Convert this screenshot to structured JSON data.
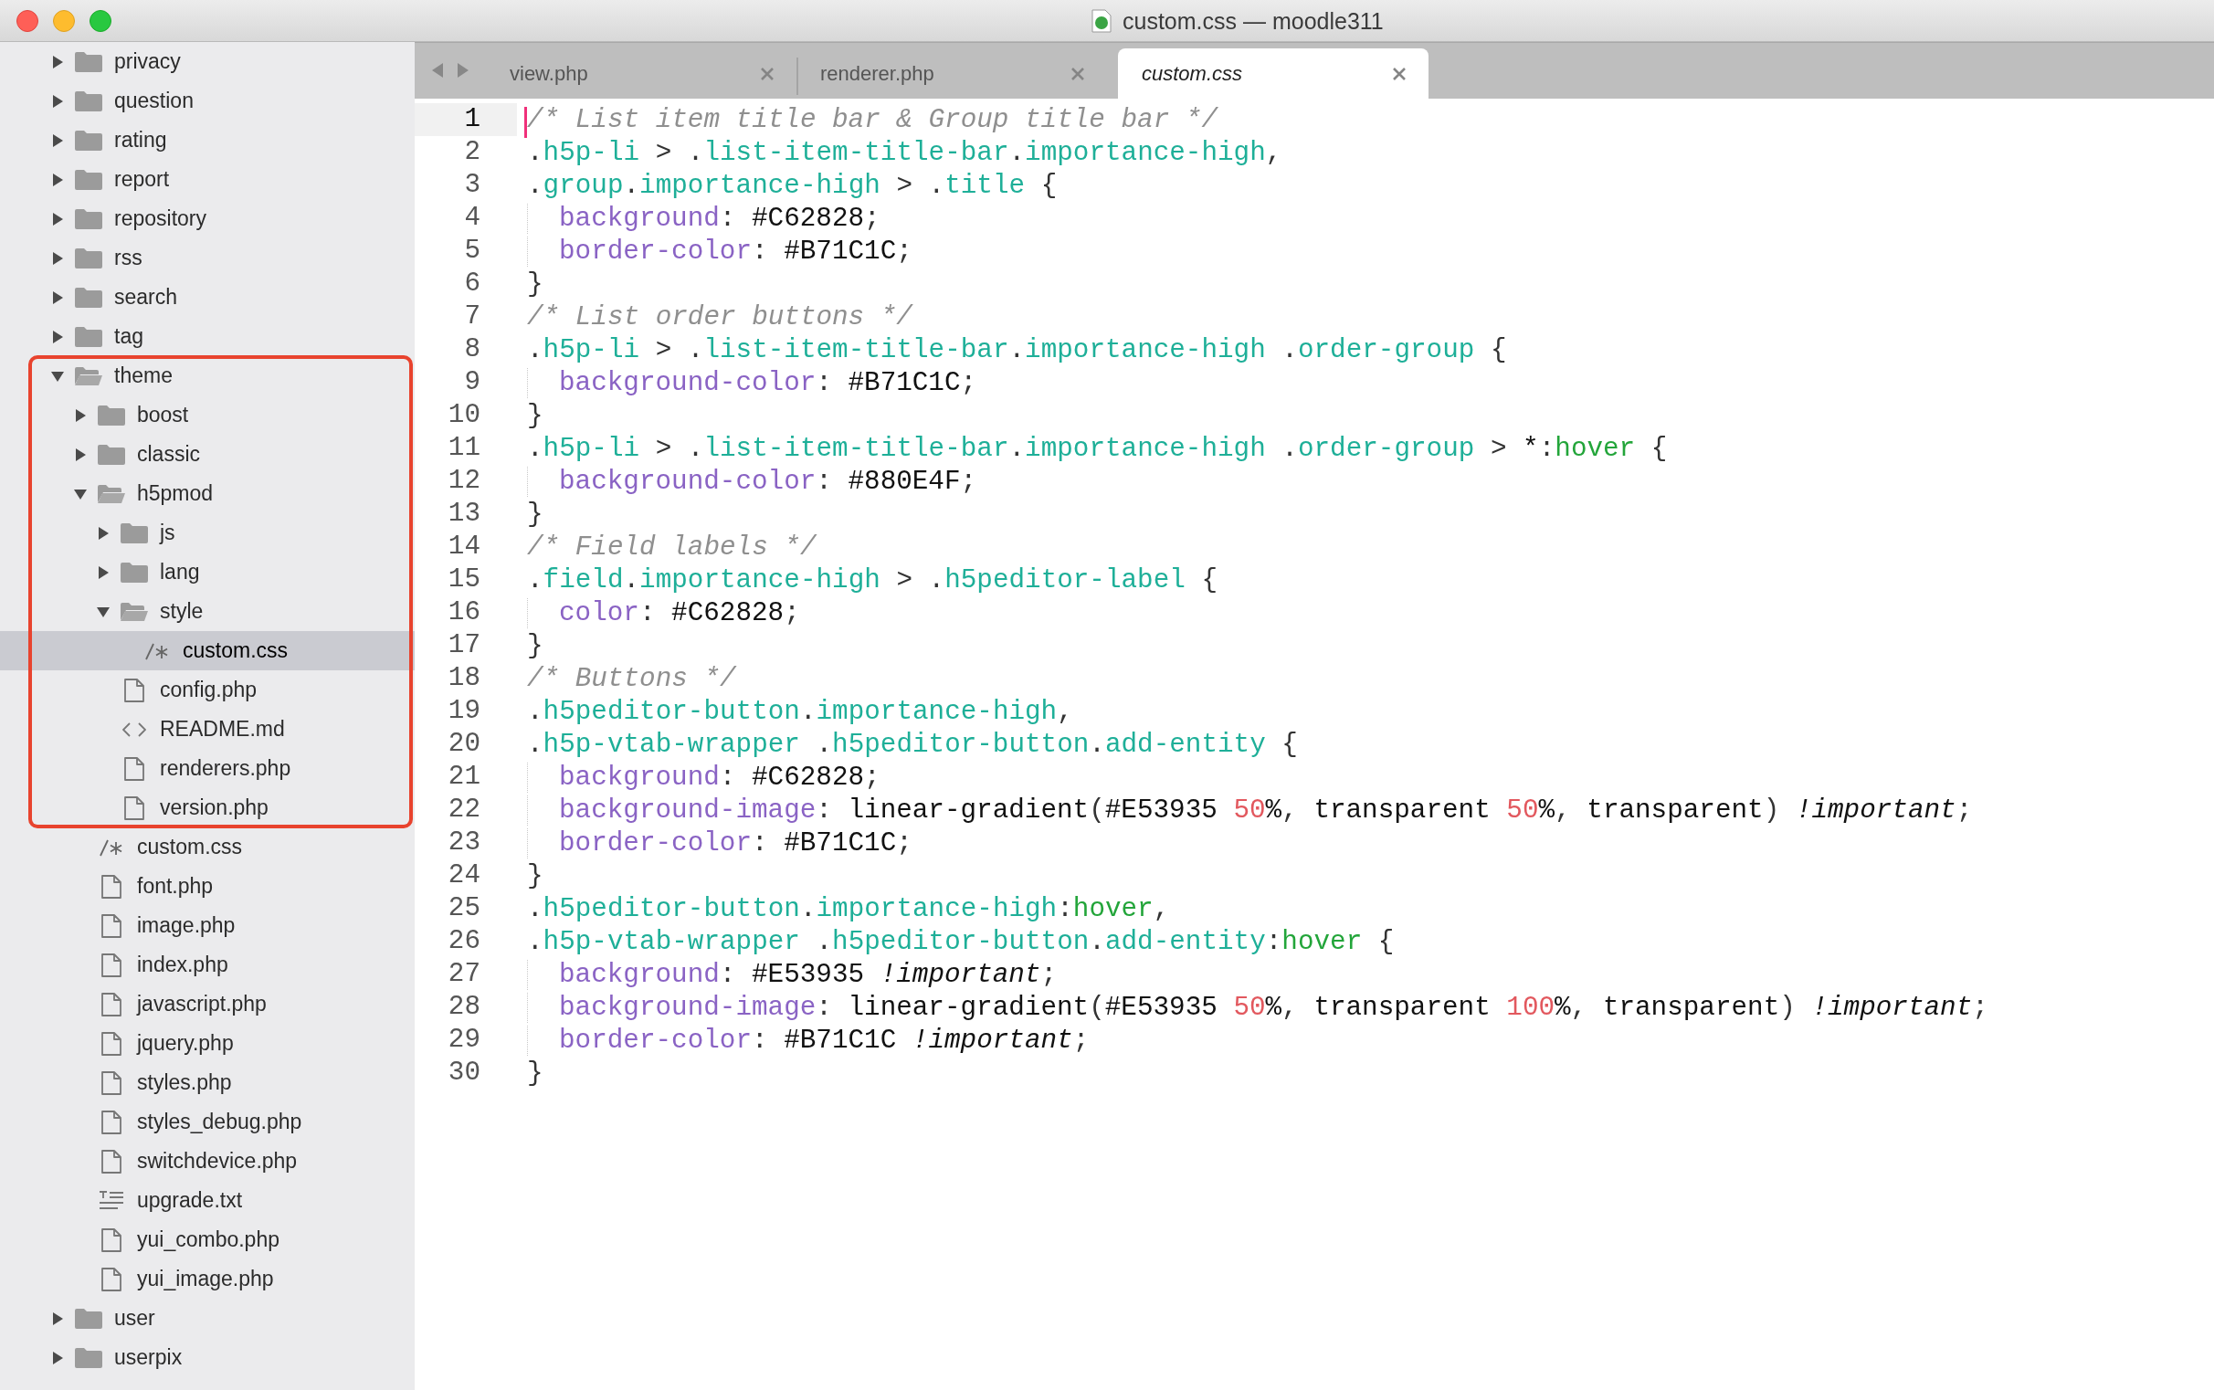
{
  "window": {
    "title": "custom.css — moodle311"
  },
  "sidebar": {
    "items": [
      {
        "name": "privacy",
        "kind": "folder",
        "expanded": false,
        "selected": false,
        "boxed": false
      },
      {
        "name": "question",
        "kind": "folder",
        "expanded": false,
        "selected": false,
        "boxed": false
      },
      {
        "name": "rating",
        "kind": "folder",
        "expanded": false,
        "selected": false,
        "boxed": false
      },
      {
        "name": "report",
        "kind": "folder",
        "expanded": false,
        "selected": false,
        "boxed": false
      },
      {
        "name": "repository",
        "kind": "folder",
        "expanded": false,
        "selected": false,
        "boxed": false
      },
      {
        "name": "rss",
        "kind": "folder",
        "expanded": false,
        "selected": false,
        "boxed": false
      },
      {
        "name": "search",
        "kind": "folder",
        "expanded": false,
        "selected": false,
        "boxed": false
      },
      {
        "name": "tag",
        "kind": "folder",
        "expanded": false,
        "selected": false,
        "boxed": false
      },
      {
        "name": "theme",
        "kind": "folder",
        "expanded": true,
        "selected": false,
        "boxed": true,
        "children": [
          {
            "name": "boost",
            "kind": "folder",
            "expanded": false,
            "selected": false,
            "boxed": true
          },
          {
            "name": "classic",
            "kind": "folder",
            "expanded": false,
            "selected": false,
            "boxed": true
          },
          {
            "name": "h5pmod",
            "kind": "folder",
            "expanded": true,
            "selected": false,
            "boxed": true,
            "children": [
              {
                "name": "js",
                "kind": "folder",
                "expanded": false,
                "selected": false,
                "boxed": true
              },
              {
                "name": "lang",
                "kind": "folder",
                "expanded": false,
                "selected": false,
                "boxed": true
              },
              {
                "name": "style",
                "kind": "folder",
                "expanded": true,
                "selected": false,
                "boxed": true,
                "children": [
                  {
                    "name": "custom.css",
                    "kind": "css",
                    "selected": true,
                    "boxed": true
                  }
                ]
              },
              {
                "name": "config.php",
                "kind": "page",
                "selected": false,
                "boxed": true
              },
              {
                "name": "README.md",
                "kind": "code",
                "selected": false,
                "boxed": true
              },
              {
                "name": "renderers.php",
                "kind": "page",
                "selected": false,
                "boxed": true
              },
              {
                "name": "version.php",
                "kind": "page",
                "selected": false,
                "boxed": true
              }
            ]
          },
          {
            "name": "custom.css",
            "kind": "css",
            "selected": false,
            "boxed": false
          },
          {
            "name": "font.php",
            "kind": "page",
            "selected": false,
            "boxed": false
          },
          {
            "name": "image.php",
            "kind": "page",
            "selected": false,
            "boxed": false
          },
          {
            "name": "index.php",
            "kind": "page",
            "selected": false,
            "boxed": false
          },
          {
            "name": "javascript.php",
            "kind": "page",
            "selected": false,
            "boxed": false
          },
          {
            "name": "jquery.php",
            "kind": "page",
            "selected": false,
            "boxed": false
          },
          {
            "name": "styles.php",
            "kind": "page",
            "selected": false,
            "boxed": false
          },
          {
            "name": "styles_debug.php",
            "kind": "page",
            "selected": false,
            "boxed": false
          },
          {
            "name": "switchdevice.php",
            "kind": "page",
            "selected": false,
            "boxed": false
          },
          {
            "name": "upgrade.txt",
            "kind": "text",
            "selected": false,
            "boxed": false
          },
          {
            "name": "yui_combo.php",
            "kind": "page",
            "selected": false,
            "boxed": false
          },
          {
            "name": "yui_image.php",
            "kind": "page",
            "selected": false,
            "boxed": false
          }
        ]
      },
      {
        "name": "user",
        "kind": "folder",
        "expanded": false,
        "selected": false,
        "boxed": false
      },
      {
        "name": "userpix",
        "kind": "folder",
        "expanded": false,
        "selected": false,
        "boxed": false
      }
    ]
  },
  "tabs": [
    {
      "label": "view.php",
      "selected": false
    },
    {
      "label": "renderer.php",
      "selected": false
    },
    {
      "label": "custom.css",
      "selected": true
    }
  ],
  "editor": {
    "lines": [
      {
        "number": "1",
        "current": true,
        "indented": false,
        "tokens": [
          {
            "kind": "comment",
            "text": "/* List item title bar & Group title bar */"
          }
        ]
      },
      {
        "number": "2",
        "current": false,
        "indented": false,
        "tokens": [
          {
            "kind": "punct",
            "text": "."
          },
          {
            "kind": "selector",
            "text": "h5p-li"
          },
          {
            "kind": "punct",
            "text": " > ."
          },
          {
            "kind": "selector",
            "text": "list-item-title-bar"
          },
          {
            "kind": "punct",
            "text": "."
          },
          {
            "kind": "selector",
            "text": "importance-high"
          },
          {
            "kind": "punct",
            "text": ","
          }
        ]
      },
      {
        "number": "3",
        "current": false,
        "indented": false,
        "tokens": [
          {
            "kind": "punct",
            "text": "."
          },
          {
            "kind": "selector",
            "text": "group"
          },
          {
            "kind": "punct",
            "text": "."
          },
          {
            "kind": "selector",
            "text": "importance-high"
          },
          {
            "kind": "punct",
            "text": " > ."
          },
          {
            "kind": "selector",
            "text": "title"
          },
          {
            "kind": "punct",
            "text": " {"
          }
        ]
      },
      {
        "number": "4",
        "current": false,
        "indented": true,
        "tokens": [
          {
            "kind": "property",
            "text": "background"
          },
          {
            "kind": "punct",
            "text": ": "
          },
          {
            "kind": "value",
            "text": "#C62828"
          },
          {
            "kind": "punct",
            "text": ";"
          }
        ]
      },
      {
        "number": "5",
        "current": false,
        "indented": true,
        "tokens": [
          {
            "kind": "property",
            "text": "border-color"
          },
          {
            "kind": "punct",
            "text": ": "
          },
          {
            "kind": "value",
            "text": "#B71C1C"
          },
          {
            "kind": "punct",
            "text": ";"
          }
        ]
      },
      {
        "number": "6",
        "current": false,
        "indented": false,
        "tokens": [
          {
            "kind": "punct",
            "text": "}"
          }
        ]
      },
      {
        "number": "7",
        "current": false,
        "indented": false,
        "tokens": [
          {
            "kind": "comment",
            "text": "/* List order buttons */"
          }
        ]
      },
      {
        "number": "8",
        "current": false,
        "indented": false,
        "tokens": [
          {
            "kind": "punct",
            "text": "."
          },
          {
            "kind": "selector",
            "text": "h5p-li"
          },
          {
            "kind": "punct",
            "text": " > ."
          },
          {
            "kind": "selector",
            "text": "list-item-title-bar"
          },
          {
            "kind": "punct",
            "text": "."
          },
          {
            "kind": "selector",
            "text": "importance-high"
          },
          {
            "kind": "punct",
            "text": " ."
          },
          {
            "kind": "selector",
            "text": "order-group"
          },
          {
            "kind": "punct",
            "text": " {"
          }
        ]
      },
      {
        "number": "9",
        "current": false,
        "indented": true,
        "tokens": [
          {
            "kind": "property",
            "text": "background-color"
          },
          {
            "kind": "punct",
            "text": ": "
          },
          {
            "kind": "value",
            "text": "#B71C1C"
          },
          {
            "kind": "punct",
            "text": ";"
          }
        ]
      },
      {
        "number": "10",
        "current": false,
        "indented": false,
        "tokens": [
          {
            "kind": "punct",
            "text": "}"
          }
        ]
      },
      {
        "number": "11",
        "current": false,
        "indented": false,
        "tokens": [
          {
            "kind": "punct",
            "text": "."
          },
          {
            "kind": "selector",
            "text": "h5p-li"
          },
          {
            "kind": "punct",
            "text": " > ."
          },
          {
            "kind": "selector",
            "text": "list-item-title-bar"
          },
          {
            "kind": "punct",
            "text": "."
          },
          {
            "kind": "selector",
            "text": "importance-high"
          },
          {
            "kind": "punct",
            "text": " ."
          },
          {
            "kind": "selector",
            "text": "order-group"
          },
          {
            "kind": "punct",
            "text": " > "
          },
          {
            "kind": "value",
            "text": "*"
          },
          {
            "kind": "punct",
            "text": ":"
          },
          {
            "kind": "pseudo",
            "text": "hover"
          },
          {
            "kind": "punct",
            "text": " {"
          }
        ]
      },
      {
        "number": "12",
        "current": false,
        "indented": true,
        "tokens": [
          {
            "kind": "property",
            "text": "background-color"
          },
          {
            "kind": "punct",
            "text": ": "
          },
          {
            "kind": "value",
            "text": "#880E4F"
          },
          {
            "kind": "punct",
            "text": ";"
          }
        ]
      },
      {
        "number": "13",
        "current": false,
        "indented": false,
        "tokens": [
          {
            "kind": "punct",
            "text": "}"
          }
        ]
      },
      {
        "number": "14",
        "current": false,
        "indented": false,
        "tokens": [
          {
            "kind": "comment",
            "text": "/* Field labels */"
          }
        ]
      },
      {
        "number": "15",
        "current": false,
        "indented": false,
        "tokens": [
          {
            "kind": "punct",
            "text": "."
          },
          {
            "kind": "selector",
            "text": "field"
          },
          {
            "kind": "punct",
            "text": "."
          },
          {
            "kind": "selector",
            "text": "importance-high"
          },
          {
            "kind": "punct",
            "text": " > ."
          },
          {
            "kind": "selector",
            "text": "h5peditor-label"
          },
          {
            "kind": "punct",
            "text": " {"
          }
        ]
      },
      {
        "number": "16",
        "current": false,
        "indented": true,
        "tokens": [
          {
            "kind": "property",
            "text": "color"
          },
          {
            "kind": "punct",
            "text": ": "
          },
          {
            "kind": "value",
            "text": "#C62828"
          },
          {
            "kind": "punct",
            "text": ";"
          }
        ]
      },
      {
        "number": "17",
        "current": false,
        "indented": false,
        "tokens": [
          {
            "kind": "punct",
            "text": "}"
          }
        ]
      },
      {
        "number": "18",
        "current": false,
        "indented": false,
        "tokens": [
          {
            "kind": "comment",
            "text": "/* Buttons */"
          }
        ]
      },
      {
        "number": "19",
        "current": false,
        "indented": false,
        "tokens": [
          {
            "kind": "punct",
            "text": "."
          },
          {
            "kind": "selector",
            "text": "h5peditor-button"
          },
          {
            "kind": "punct",
            "text": "."
          },
          {
            "kind": "selector",
            "text": "importance-high"
          },
          {
            "kind": "punct",
            "text": ","
          }
        ]
      },
      {
        "number": "20",
        "current": false,
        "indented": false,
        "tokens": [
          {
            "kind": "punct",
            "text": "."
          },
          {
            "kind": "selector",
            "text": "h5p-vtab-wrapper"
          },
          {
            "kind": "punct",
            "text": " ."
          },
          {
            "kind": "selector",
            "text": "h5peditor-button"
          },
          {
            "kind": "punct",
            "text": "."
          },
          {
            "kind": "selector",
            "text": "add-entity"
          },
          {
            "kind": "punct",
            "text": " {"
          }
        ]
      },
      {
        "number": "21",
        "current": false,
        "indented": true,
        "tokens": [
          {
            "kind": "property",
            "text": "background"
          },
          {
            "kind": "punct",
            "text": ": "
          },
          {
            "kind": "value",
            "text": "#C62828"
          },
          {
            "kind": "punct",
            "text": ";"
          }
        ]
      },
      {
        "number": "22",
        "current": false,
        "indented": true,
        "tokens": [
          {
            "kind": "property",
            "text": "background-image"
          },
          {
            "kind": "punct",
            "text": ": "
          },
          {
            "kind": "value",
            "text": "linear-gradient"
          },
          {
            "kind": "punct",
            "text": "("
          },
          {
            "kind": "value",
            "text": "#E53935 "
          },
          {
            "kind": "number",
            "text": "50"
          },
          {
            "kind": "value",
            "text": "%"
          },
          {
            "kind": "punct",
            "text": ", "
          },
          {
            "kind": "value",
            "text": "transparent "
          },
          {
            "kind": "number",
            "text": "50"
          },
          {
            "kind": "value",
            "text": "%"
          },
          {
            "kind": "punct",
            "text": ", "
          },
          {
            "kind": "value",
            "text": "transparent"
          },
          {
            "kind": "punct",
            "text": ") "
          },
          {
            "kind": "important",
            "text": "!important"
          },
          {
            "kind": "punct",
            "text": ";"
          }
        ]
      },
      {
        "number": "23",
        "current": false,
        "indented": true,
        "tokens": [
          {
            "kind": "property",
            "text": "border-color"
          },
          {
            "kind": "punct",
            "text": ": "
          },
          {
            "kind": "value",
            "text": "#B71C1C"
          },
          {
            "kind": "punct",
            "text": ";"
          }
        ]
      },
      {
        "number": "24",
        "current": false,
        "indented": false,
        "tokens": [
          {
            "kind": "punct",
            "text": "}"
          }
        ]
      },
      {
        "number": "25",
        "current": false,
        "indented": false,
        "tokens": [
          {
            "kind": "punct",
            "text": "."
          },
          {
            "kind": "selector",
            "text": "h5peditor-button"
          },
          {
            "kind": "punct",
            "text": "."
          },
          {
            "kind": "selector",
            "text": "importance-high"
          },
          {
            "kind": "punct",
            "text": ":"
          },
          {
            "kind": "pseudo",
            "text": "hover"
          },
          {
            "kind": "punct",
            "text": ","
          }
        ]
      },
      {
        "number": "26",
        "current": false,
        "indented": false,
        "tokens": [
          {
            "kind": "punct",
            "text": "."
          },
          {
            "kind": "selector",
            "text": "h5p-vtab-wrapper"
          },
          {
            "kind": "punct",
            "text": " ."
          },
          {
            "kind": "selector",
            "text": "h5peditor-button"
          },
          {
            "kind": "punct",
            "text": "."
          },
          {
            "kind": "selector",
            "text": "add-entity"
          },
          {
            "kind": "punct",
            "text": ":"
          },
          {
            "kind": "pseudo",
            "text": "hover"
          },
          {
            "kind": "punct",
            "text": " {"
          }
        ]
      },
      {
        "number": "27",
        "current": false,
        "indented": true,
        "tokens": [
          {
            "kind": "property",
            "text": "background"
          },
          {
            "kind": "punct",
            "text": ": "
          },
          {
            "kind": "value",
            "text": "#E53935 "
          },
          {
            "kind": "important",
            "text": "!important"
          },
          {
            "kind": "punct",
            "text": ";"
          }
        ]
      },
      {
        "number": "28",
        "current": false,
        "indented": true,
        "tokens": [
          {
            "kind": "property",
            "text": "background-image"
          },
          {
            "kind": "punct",
            "text": ": "
          },
          {
            "kind": "value",
            "text": "linear-gradient"
          },
          {
            "kind": "punct",
            "text": "("
          },
          {
            "kind": "value",
            "text": "#E53935 "
          },
          {
            "kind": "number",
            "text": "50"
          },
          {
            "kind": "value",
            "text": "%"
          },
          {
            "kind": "punct",
            "text": ", "
          },
          {
            "kind": "value",
            "text": "transparent "
          },
          {
            "kind": "number",
            "text": "100"
          },
          {
            "kind": "value",
            "text": "%"
          },
          {
            "kind": "punct",
            "text": ", "
          },
          {
            "kind": "value",
            "text": "transparent"
          },
          {
            "kind": "punct",
            "text": ") "
          },
          {
            "kind": "important",
            "text": "!important"
          },
          {
            "kind": "punct",
            "text": ";"
          }
        ]
      },
      {
        "number": "29",
        "current": false,
        "indented": true,
        "tokens": [
          {
            "kind": "property",
            "text": "border-color"
          },
          {
            "kind": "punct",
            "text": ": "
          },
          {
            "kind": "value",
            "text": "#B71C1C "
          },
          {
            "kind": "important",
            "text": "!important"
          },
          {
            "kind": "punct",
            "text": ";"
          }
        ]
      },
      {
        "number": "30",
        "current": false,
        "indented": false,
        "tokens": [
          {
            "kind": "punct",
            "text": "}"
          }
        ]
      }
    ]
  }
}
